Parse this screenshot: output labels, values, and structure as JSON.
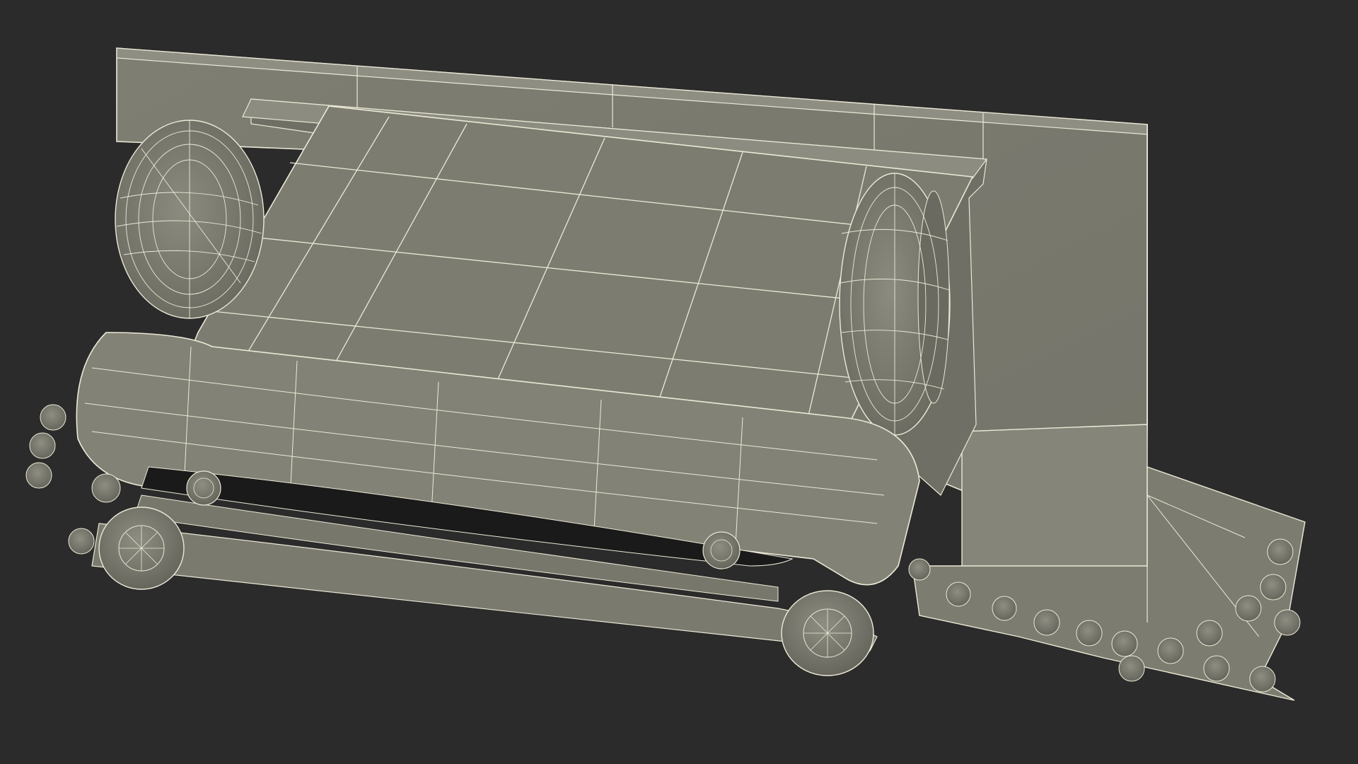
{
  "scene": {
    "background_color": "#2b2b2b",
    "surface_color": "#7b7b6f",
    "surface_dark_color": "#5f5f56",
    "surface_light_color": "#8a8a7e",
    "shadow_color": "#151515",
    "wire_color": "#ece9d6"
  }
}
